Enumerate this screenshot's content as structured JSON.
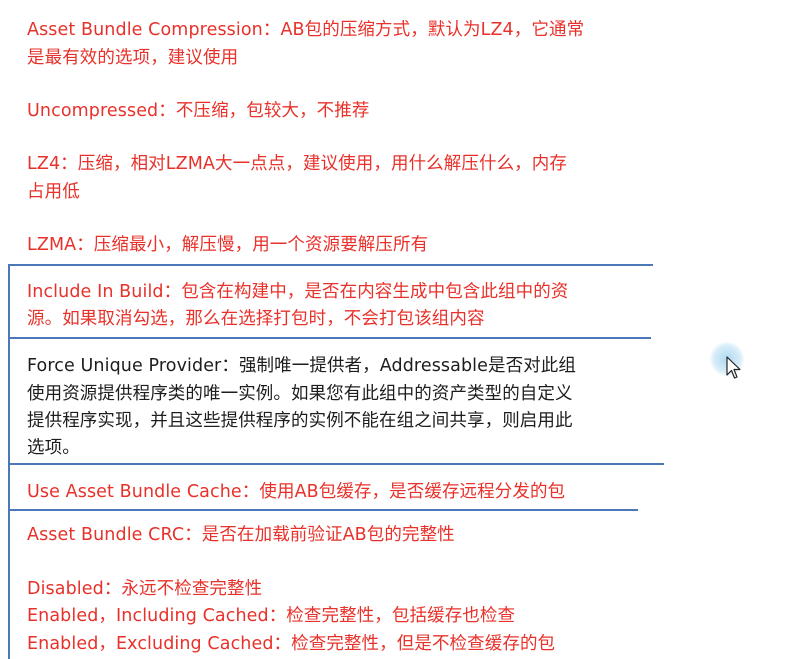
{
  "sections": {
    "compression": {
      "line1": "Asset Bundle Compression：AB包的压缩方式，默认为LZ4，它通常",
      "line2": "是最有效的选项，建议使用",
      "uncompressed": "Uncompressed：不压缩，包较大，不推荐",
      "lz4_line1": "LZ4：压缩，相对LZMA大一点点，建议使用，用什么解压什么，内存",
      "lz4_line2": "占用低",
      "lzma": "LZMA：压缩最小，解压慢，用一个资源要解压所有"
    },
    "include_in_build": {
      "line1": "Include In Build：包含在构建中，是否在内容生成中包含此组中的资",
      "line2": "源。如果取消勾选，那么在选择打包时，不会打包该组内容"
    },
    "force_unique_provider": {
      "line1": "Force Unique Provider：强制唯一提供者，Addressable是否对此组",
      "line2": "使用资源提供程序类的唯一实例。如果您有此组中的资产类型的自定义",
      "line3": "提供程序实现，并且这些提供程序的实例不能在组之间共享，则启用此",
      "line4": "选项。"
    },
    "use_asset_bundle_cache": {
      "line1": "Use Asset Bundle Cache：使用AB包缓存，是否缓存远程分发的包"
    },
    "asset_bundle_crc": {
      "line1": "Asset Bundle CRC：是否在加载前验证AB包的完整性",
      "disabled": "Disabled：永远不检查完整性",
      "enabled_including": "Enabled，Including Cached：检查完整性，包括缓存也检查",
      "enabled_excluding": "Enabled，Excluding Cached：检查完整性，但是不检查缓存的包"
    }
  },
  "colors": {
    "text_red": "#e8312a",
    "text_dark": "#1d1d1d",
    "separator_blue": "#4a78b8"
  },
  "icons": {
    "cursor": "mouse-pointer-icon"
  }
}
